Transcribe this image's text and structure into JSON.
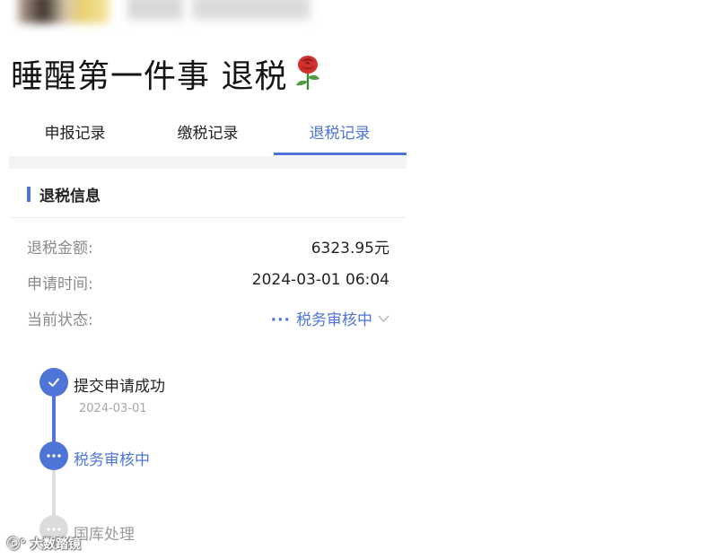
{
  "post": {
    "title": "睡醒第一件事 退税"
  },
  "tabs": [
    {
      "label": "申报记录",
      "active": false
    },
    {
      "label": "缴税记录",
      "active": false
    },
    {
      "label": "退税记录",
      "active": true
    }
  ],
  "section": {
    "title": "退税信息"
  },
  "info": {
    "amount_label": "退税金额:",
    "amount_value": "6323.95元",
    "time_label": "申请时间:",
    "time_value": "2024-03-01 06:04",
    "status_label": "当前状态:",
    "status_value": "税务审核中"
  },
  "timeline": {
    "steps": [
      {
        "label": "提交申请成功",
        "date": "2024-03-01",
        "state": "done"
      },
      {
        "label": "税务审核中",
        "state": "current"
      },
      {
        "label": "国库处理",
        "state": "pending"
      }
    ]
  },
  "colors": {
    "accent": "#4d74d6",
    "muted": "#8a8a8a",
    "pending": "#dcdcdc"
  },
  "icons": {
    "title_emoji": "rose-icon",
    "status_dots": "ellipsis-icon",
    "status_chevron": "chevron-down-icon",
    "step_done": "check-icon",
    "step_current": "ellipsis-icon",
    "step_pending": "ellipsis-icon"
  }
}
